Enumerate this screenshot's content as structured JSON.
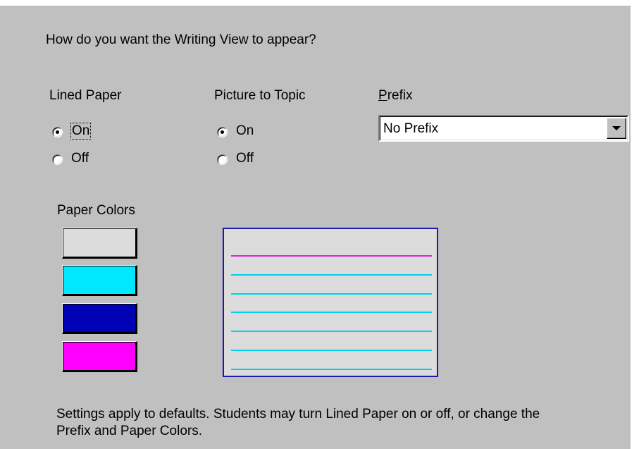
{
  "question": "How do you want the Writing View to appear?",
  "lined_paper": {
    "label": "Lined Paper",
    "options": [
      "On",
      "Off"
    ],
    "selected": "On"
  },
  "picture_to_topic": {
    "label": "Picture to Topic",
    "options": [
      "On",
      "Off"
    ],
    "selected": "On"
  },
  "prefix": {
    "label_underlined_char": "P",
    "label_rest": "refix",
    "value": "No Prefix"
  },
  "paper_colors": {
    "label": "Paper Colors",
    "swatches": [
      "#dcdcdc",
      "#00e8ff",
      "#0000b4",
      "#ff00ff"
    ]
  },
  "preview": {
    "background": "#dcdcdc",
    "border_color": "#1a1ab0",
    "top_line_color": "#e020e0",
    "line_color": "#00d0e8",
    "line_count": 7
  },
  "footer": {
    "line1": "Settings apply to defaults. Students may turn Lined Paper on or off, or change the",
    "line2": "Prefix and Paper Colors."
  }
}
